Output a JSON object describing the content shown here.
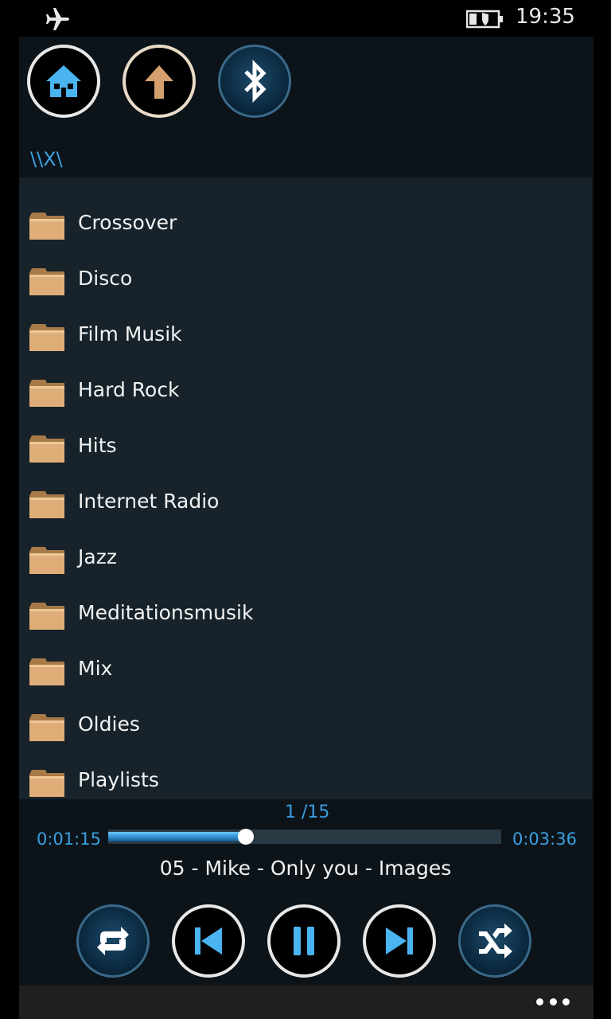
{
  "status_bar": {
    "time": "19:35",
    "icons": [
      "airplane-mode-icon",
      "battery-saver-icon"
    ]
  },
  "toolbar": {
    "buttons": [
      {
        "name": "home",
        "icon": "home-icon",
        "color": "#4ab4f0"
      },
      {
        "name": "up",
        "icon": "arrow-up-icon",
        "color": "#d4a070"
      },
      {
        "name": "bluetooth",
        "icon": "bluetooth-icon",
        "color": "#ffffff"
      }
    ]
  },
  "path": "\\\\X\\",
  "folders": [
    {
      "label": "Crossover"
    },
    {
      "label": "Disco"
    },
    {
      "label": "Film Musik"
    },
    {
      "label": "Hard Rock"
    },
    {
      "label": "Hits"
    },
    {
      "label": "Internet Radio"
    },
    {
      "label": "Jazz"
    },
    {
      "label": "Meditationsmusik"
    },
    {
      "label": "Mix"
    },
    {
      "label": "Oldies"
    },
    {
      "label": "Playlists"
    }
  ],
  "player": {
    "track_count": "1 /15",
    "elapsed": "0:01:15",
    "total": "0:03:36",
    "progress": 0.35,
    "now_playing": "05 - Mike - Only you - Images",
    "controls": [
      {
        "name": "repeat",
        "icon": "repeat-icon"
      },
      {
        "name": "previous",
        "icon": "skip-previous-icon"
      },
      {
        "name": "pause",
        "icon": "pause-icon"
      },
      {
        "name": "next",
        "icon": "skip-next-icon"
      },
      {
        "name": "shuffle",
        "icon": "shuffle-icon"
      }
    ]
  },
  "app_bar": {
    "more_icon": "more-dots-icon"
  },
  "colors": {
    "accent": "#3a9fe0",
    "folder": "#d9a870",
    "background": "#17222a"
  }
}
